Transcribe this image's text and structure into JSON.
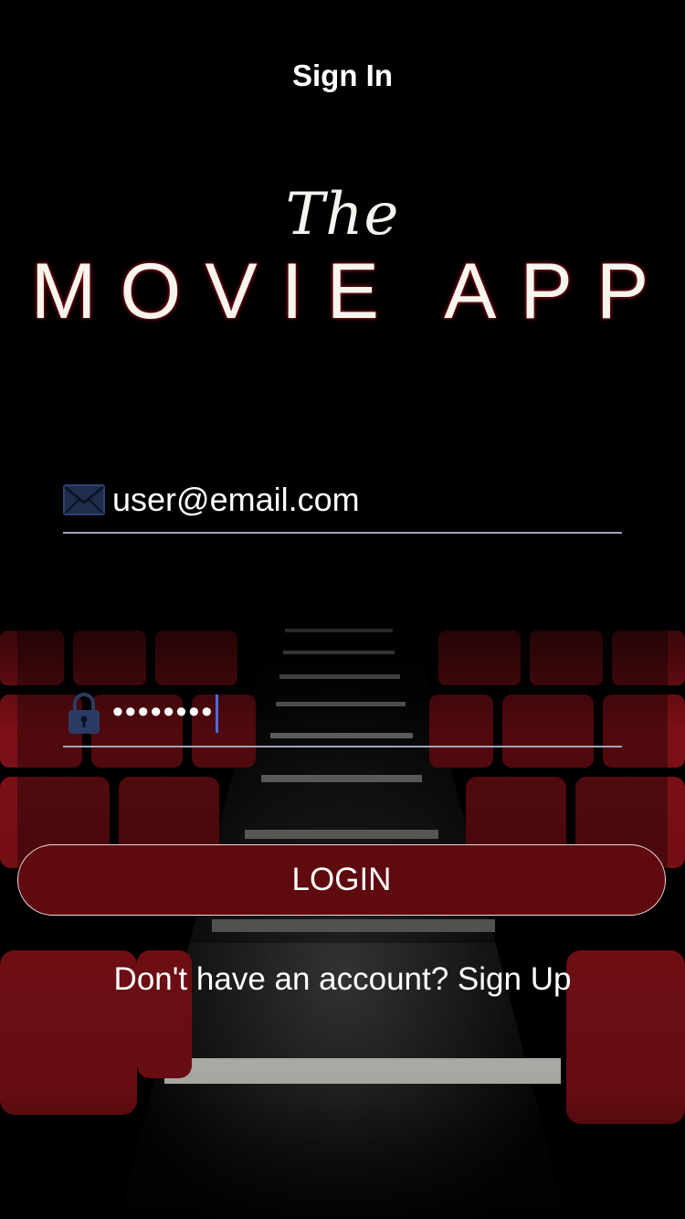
{
  "nav": {
    "title": "Sign In"
  },
  "logo": {
    "the": "The",
    "main": "MOVIE APP"
  },
  "email": {
    "value": "user@email.com",
    "icon": "envelope-icon"
  },
  "password": {
    "value": "••••••••",
    "icon": "lock-icon"
  },
  "login": {
    "label": "LOGIN"
  },
  "signup": {
    "prompt": "Don't have an account? Sign Up"
  },
  "colors": {
    "accent": "#5e0a0f",
    "caret": "#4a6cf2",
    "seat": "#8b1219"
  }
}
